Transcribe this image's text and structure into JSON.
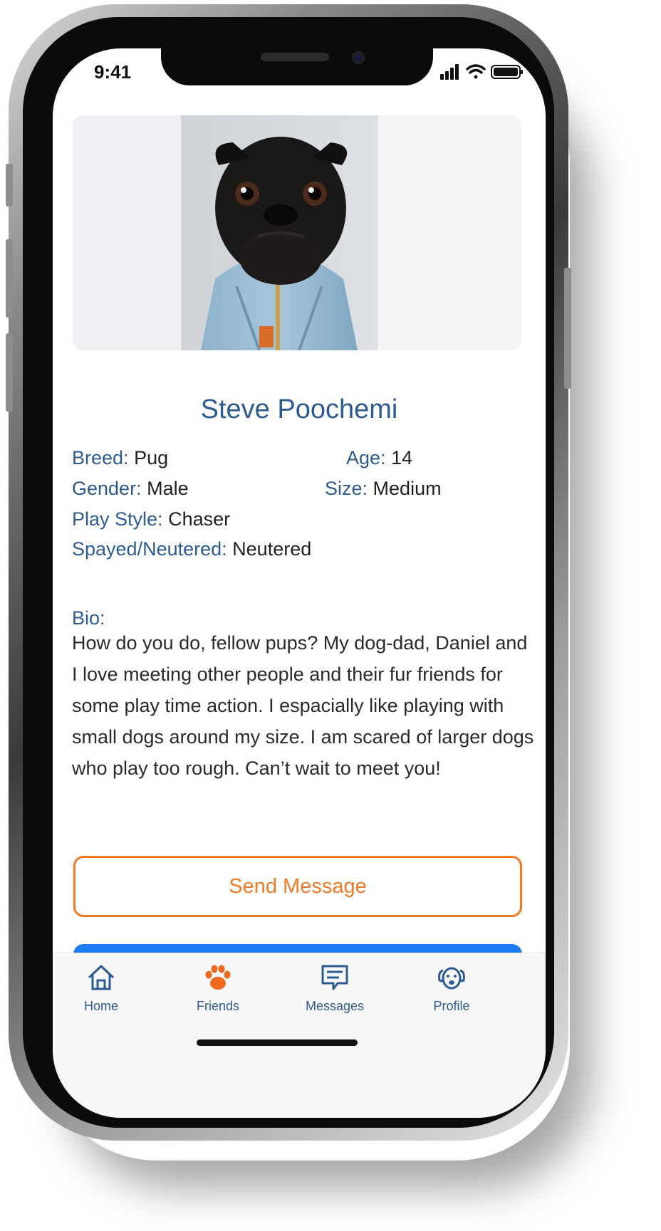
{
  "status_bar": {
    "time": "9:41"
  },
  "profile": {
    "name": "Steve Poochemi",
    "photo_icon": "pug-in-denim-jacket-photo",
    "breed_label": "Breed:",
    "breed": "Pug",
    "age_label": "Age:",
    "age": "14",
    "gender_label": "Gender:",
    "gender": "Male",
    "size_label": "Size:",
    "size": "Medium",
    "play_style_label": "Play Style:",
    "play_style": "Chaser",
    "spayed_label": "Spayed/Neutered:",
    "spayed": "Neutered",
    "bio_label": "Bio:",
    "bio": "How do you do, fellow pups? My dog-dad, Daniel and I love meeting other people and their fur friends for some play time action. I espacially like playing with small dogs around my size. I am scared of larger dogs who play too rough. Can’t wait to meet you!"
  },
  "actions": {
    "send_message": "Send Message"
  },
  "tabbar": {
    "items": [
      {
        "label": "Home",
        "icon": "home-icon"
      },
      {
        "label": "Friends",
        "icon": "paw-icon"
      },
      {
        "label": "Messages",
        "icon": "chat-icon"
      },
      {
        "label": "Profile",
        "icon": "dog-face-icon"
      }
    ]
  },
  "colors": {
    "accent_blue": "#2d5b91",
    "accent_orange": "#f07a26",
    "button_blue": "#1d7cf2"
  }
}
